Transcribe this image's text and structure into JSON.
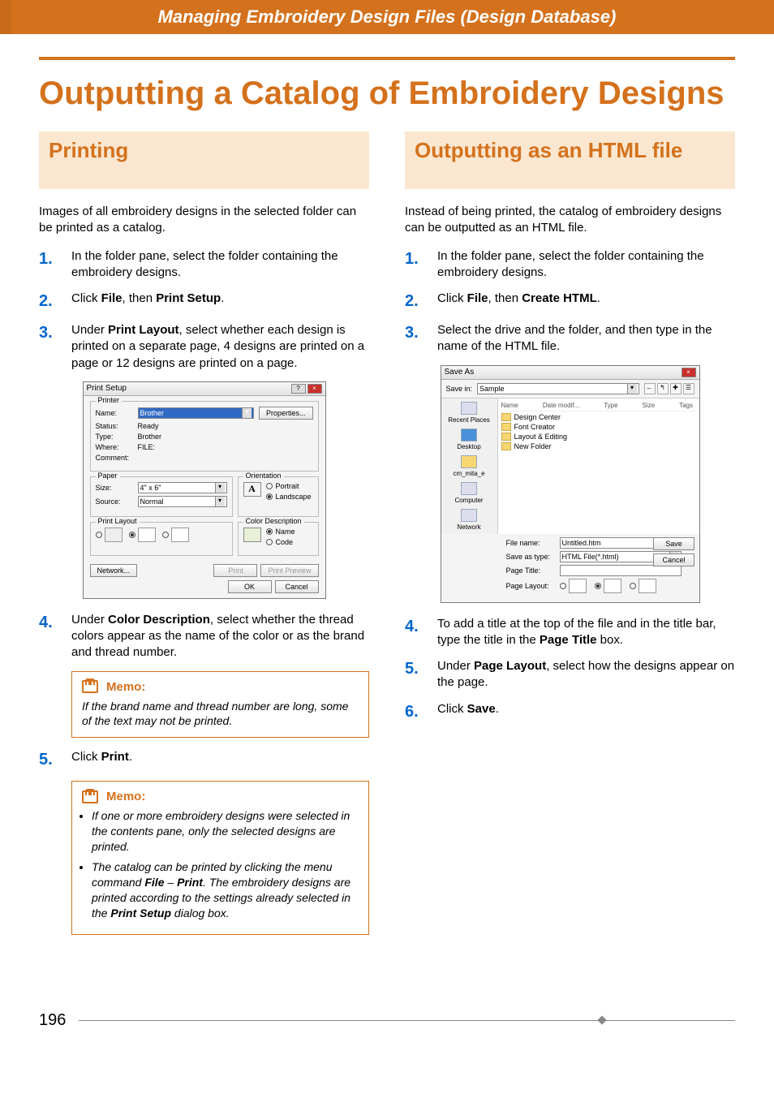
{
  "header_banner": "Managing Embroidery Design Files (Design Database)",
  "main_title": "Outputting a Catalog of Embroidery Designs",
  "page_number": "196",
  "left": {
    "heading": "Printing",
    "intro": "Images of all embroidery designs in the selected folder can be printed as a catalog.",
    "steps": [
      {
        "num": "1.",
        "text": "In the folder pane, select the folder containing the embroidery designs."
      },
      {
        "num": "2.",
        "pre": "Click ",
        "b1": "File",
        "mid": ", then ",
        "b2": "Print Setup",
        "post": "."
      },
      {
        "num": "3.",
        "pre": "Under ",
        "b1": "Print Layout",
        "post": ", select whether each design is printed on a separate page, 4 designs are printed on a page or 12 designs are printed on a page."
      },
      {
        "num": "4.",
        "pre": "Under ",
        "b1": "Color Description",
        "post": ", select whether the thread colors appear as the name of the color or as the brand and thread number."
      },
      {
        "num": "5.",
        "pre": "Click ",
        "b1": "Print",
        "post": "."
      }
    ],
    "memo1": {
      "title": "Memo:",
      "text": "If the brand name and thread number are long, some of the text may not be printed."
    },
    "memo2": {
      "title": "Memo:",
      "bullet1_pre": "If one or more embroidery designs were selected in the contents pane, only the selected designs are printed.",
      "bullet2_pre": "The catalog can be printed by clicking the menu command ",
      "bullet2_b1": "File",
      "bullet2_mid": " – ",
      "bullet2_b2": "Print",
      "bullet2_post": ". The embroidery designs are printed according to the settings already selected in the ",
      "bullet2_b3": "Print Setup",
      "bullet2_end": " dialog box."
    },
    "print_dialog": {
      "title": "Print Setup",
      "printer": {
        "group": "Printer",
        "name_label": "Name:",
        "name_value": "Brother",
        "properties_btn": "Properties...",
        "status_label": "Status:",
        "status_value": "Ready",
        "type_label": "Type:",
        "type_value": "Brother",
        "where_label": "Where:",
        "where_value": "FILE:",
        "comment_label": "Comment:"
      },
      "paper": {
        "group": "Paper",
        "size_label": "Size:",
        "size_value": "4\" x 6\"",
        "source_label": "Source:",
        "source_value": "Normal"
      },
      "orientation": {
        "group": "Orientation",
        "portrait": "Portrait",
        "landscape": "Landscape"
      },
      "print_layout_group": "Print Layout",
      "color_desc": {
        "group": "Color Description",
        "name": "Name",
        "code": "Code"
      },
      "network_btn": "Network...",
      "print_btn": "Print",
      "preview_btn": "Print Preview",
      "ok_btn": "OK",
      "cancel_btn": "Cancel"
    }
  },
  "right": {
    "heading": "Outputting as an HTML file",
    "intro": "Instead of being printed, the catalog of embroidery designs can be outputted as an HTML file.",
    "steps": [
      {
        "num": "1.",
        "text": "In the folder pane, select the folder containing the embroidery designs."
      },
      {
        "num": "2.",
        "pre": "Click ",
        "b1": "File",
        "mid": ", then ",
        "b2": "Create HTML",
        "post": "."
      },
      {
        "num": "3.",
        "text": "Select the drive and the folder, and then type in the name of the HTML file."
      },
      {
        "num": "4.",
        "pre": "To add a title at the top of the file and in the title bar, type the title in the ",
        "b1": "Page Title",
        "post": " box."
      },
      {
        "num": "5.",
        "pre": "Under ",
        "b1": "Page Layout",
        "post": ", select how the designs appear on the page."
      },
      {
        "num": "6.",
        "pre": "Click ",
        "b1": "Save",
        "post": "."
      }
    ],
    "save_dialog": {
      "title": "Save As",
      "savein_label": "Save in:",
      "savein_value": "Sample",
      "cols": {
        "name": "Name",
        "date": "Date modif...",
        "type": "Type",
        "size": "Size",
        "tags": "Tags"
      },
      "folders": [
        "Design Center",
        "Font Creator",
        "Layout & Editing",
        "New Folder"
      ],
      "sidebar": {
        "recent": "Recent Places",
        "desktop": "Desktop",
        "userdir": "cm_mita_e",
        "computer": "Computer",
        "network": "Network"
      },
      "file_name_label": "File name:",
      "file_name_value": "Untitled.htm",
      "save_type_label": "Save as type:",
      "save_type_value": "HTML File(*.html)",
      "page_title_label": "Page Title:",
      "page_layout_label": "Page Layout:",
      "save_btn": "Save",
      "cancel_btn": "Cancel"
    }
  }
}
